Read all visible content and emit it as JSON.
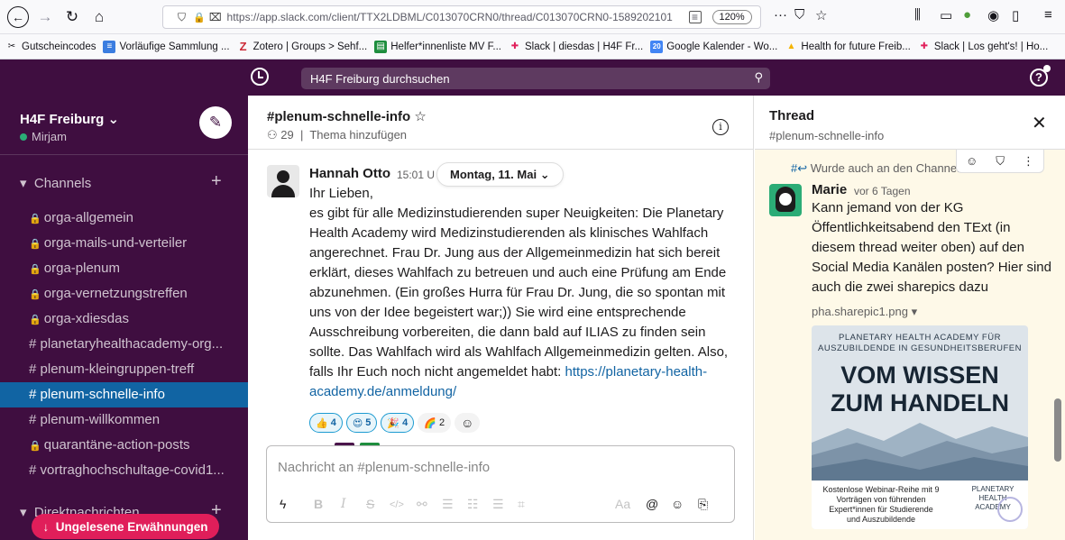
{
  "browser": {
    "url": "https://app.slack.com/client/TTX2LDBML/C013070CRN0/thread/C013070CRN0-1589202101",
    "zoom": "120%",
    "bookmarks": [
      "Gutscheincodes",
      "Vorläufige Sammlung ...",
      "Zotero | Groups > Sehf...",
      "Helfer*innenliste MV F...",
      "Slack | diesdas | H4F Fr...",
      "Google Kalender - Wo...",
      "Health for future Freib...",
      "Slack | Los geht's! | Ho..."
    ],
    "calendar_badge": "20"
  },
  "search": {
    "placeholder": "H4F Freiburg durchsuchen"
  },
  "workspace": {
    "name": "H4F Freiburg",
    "user": "Mirjam"
  },
  "sidebar": {
    "channels_label": "Channels",
    "channels": [
      {
        "prefix": "lock",
        "name": "orga-allgemein"
      },
      {
        "prefix": "lock",
        "name": "orga-mails-und-verteiler"
      },
      {
        "prefix": "lock",
        "name": "orga-plenum"
      },
      {
        "prefix": "lock",
        "name": "orga-vernetzungstreffen"
      },
      {
        "prefix": "lock",
        "name": "orga-xdiesdas"
      },
      {
        "prefix": "hash",
        "name": "planetaryhealthacademy-org..."
      },
      {
        "prefix": "hash",
        "name": "plenum-kleingruppen-treff"
      },
      {
        "prefix": "hash",
        "name": "plenum-schnelle-info",
        "active": true
      },
      {
        "prefix": "hash",
        "name": "plenum-willkommen"
      },
      {
        "prefix": "lock",
        "name": "quarantäne-action-posts"
      },
      {
        "prefix": "hash",
        "name": "vortraghochschultage-covid1..."
      }
    ],
    "dm_label": "Direktnachrichten",
    "unread_button": "Ungelesene Erwähnungen"
  },
  "channel": {
    "title": "#plenum-schnelle-info",
    "members": "29",
    "topic": "Thema hinzufügen",
    "date_divider": "Montag, 11. Mai",
    "message": {
      "author": "Hannah Otto",
      "time": "15:01 U",
      "greeting": "Ihr Lieben,",
      "body": "es gibt für alle Medizinstudierenden super Neuigkeiten: Die Planetary Health Academy wird Medizinstudierenden als klinisches Wahlfach angerechnet. Frau Dr. Jung aus der Allgemeinmedizin hat sich bereit erklärt, dieses Wahlfach zu betreuen und auch eine Prüfung am Ende abzunehmen.  (Ein großes Hurra für Frau Dr. Jung, die so spontan mit uns von der Idee begeistert war;)) Sie wird eine entsprechende Ausschreibung vorbereiten, die dann bald auf ILIAS zu finden sein sollte. Das Wahlfach wird als Wahlfach Allgemeinmedizin gelten. Also, falls Ihr Euch noch nicht angemeldet habt: ",
      "link": "https://planetary-health-academy.de/anmeldung/",
      "reactions": [
        {
          "emoji": "👍",
          "count": "4"
        },
        {
          "emoji": "😍",
          "count": "5"
        },
        {
          "emoji": "🎉",
          "count": "4"
        },
        {
          "emoji": "🌈",
          "count": "2"
        }
      ]
    },
    "composer_placeholder": "Nachricht an #plenum-schnelle-info"
  },
  "thread": {
    "title": "Thread",
    "channel": "#plenum-schnelle-info",
    "also_sent": "Wurde auch an den Channel",
    "author": "Marie",
    "time": "vor 6 Tagen",
    "text": "Kann jemand von der KG Öffentlichkeitsabend den TExt (in diesem thread weiter oben) auf den Social Media Kanälen posten? Hier sind auch die zwei sharepics dazu",
    "file_name": "pha.sharepic1.png",
    "sharepic": {
      "top": "PLANETARY HEALTH ACADEMY FÜR AUSZUBILDENDE IN GESUNDHEITSBERUFEN",
      "headline_1": "VOM WISSEN",
      "headline_2": "ZUM HANDELN",
      "bottom_left": "Kostenlose Webinar-Reihe mit 9 Vorträgen von führenden Expert*innen für Studierende und Auszubildende",
      "bottom_right": "PLANETARY HEALTH ACADEMY"
    }
  },
  "colors": {
    "aubergine": "#3f0e40",
    "active_channel": "#1164a3",
    "mention_red": "#e01e5a",
    "thread_bg": "#fef9e8",
    "presence": "#2bac76"
  }
}
